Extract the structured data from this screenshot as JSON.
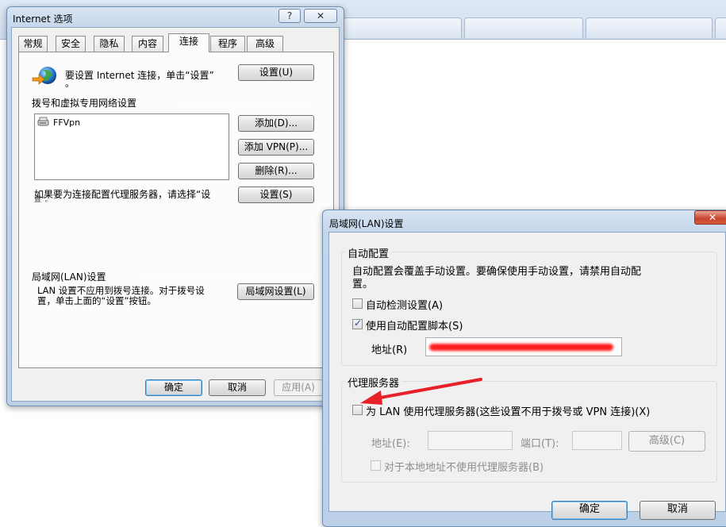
{
  "background_browser": {
    "tabs": [
      "",
      "",
      "",
      ""
    ]
  },
  "internet_options": {
    "title": "Internet 选项",
    "help_btn": "?",
    "close_btn": "✕",
    "tabs": [
      "常规",
      "安全",
      "隐私",
      "内容",
      "连接",
      "程序",
      "高级"
    ],
    "active_tab": "连接",
    "setup_text": "要设置 Internet 连接，单击“设置”",
    "setup_text_line2": "。",
    "setup_btn": "设置(U)",
    "dialup_section": "拨号和虚拟专用网络设置",
    "connections": [
      "FFVpn"
    ],
    "add_btn": "添加(D)...",
    "add_vpn_btn": "添加 VPN(P)...",
    "remove_btn": "删除(R)...",
    "proxy_text": "如果要为连接配置代理服务器，请选择“设",
    "proxy_text_line2": "置”。",
    "settings_btn": "设置(S)",
    "lan_section": "局域网(LAN)设置",
    "lan_desc_line1": "LAN 设置不应用到拨号连接。对于拨号设",
    "lan_desc_line2": "置，单击上面的“设置”按钮。",
    "lan_btn": "局域网设置(L)",
    "ok_btn": "确定",
    "cancel_btn": "取消",
    "apply_btn": "应用(A)"
  },
  "lan_dialog": {
    "title": "局域网(LAN)设置",
    "auto_config_group": "自动配置",
    "auto_config_desc_line1": "自动配置会覆盖手动设置。要确保使用手动设置，请禁用自动配",
    "auto_config_desc_line2": "置。",
    "auto_detect_label": "自动检测设置(A)",
    "auto_detect_checked": false,
    "use_script_label": "使用自动配置脚本(S)",
    "use_script_checked": true,
    "address_label": "地址(R)",
    "proxy_group": "代理服务器",
    "use_proxy_label": "为 LAN 使用代理服务器(这些设置不用于拨号或 VPN 连接)(X)",
    "use_proxy_checked": false,
    "proxy_address_label": "地址(E):",
    "port_label": "端口(T):",
    "advanced_btn": "高级(C)",
    "bypass_label": "对于本地地址不使用代理服务器(B)",
    "bypass_checked": false,
    "ok_btn": "确定",
    "cancel_btn": "取消"
  },
  "colors": {
    "annotation_arrow": "#e8202a",
    "redaction": "#ff1a1a"
  }
}
